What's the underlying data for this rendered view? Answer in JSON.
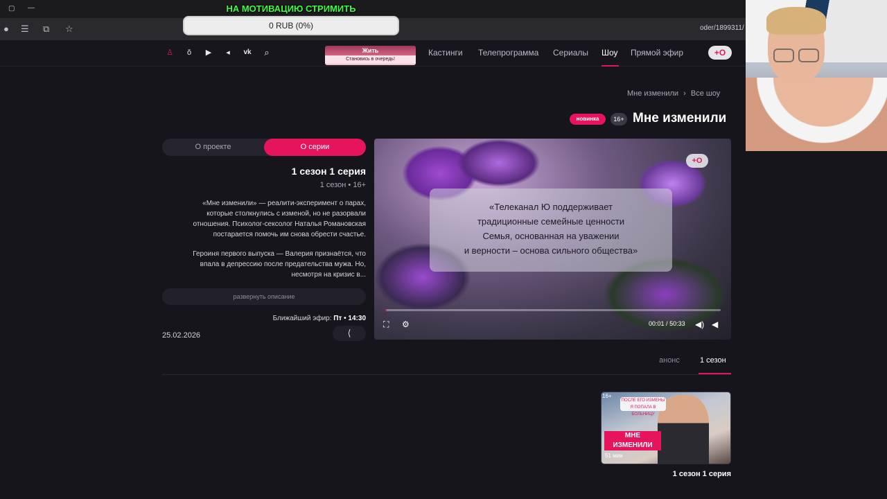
{
  "browser": {
    "url_fragment": "oder/1899311/"
  },
  "donation": {
    "title": "НА МОТИВАЦИЮ СТРИМИТЬ",
    "progress_text": "0 RUB (0%)",
    "progress_fraction": 0
  },
  "site": {
    "logo_text": "+О",
    "nav": [
      {
        "label": "Прямой эфир"
      },
      {
        "label": "Шоу"
      },
      {
        "label": "Сериалы"
      },
      {
        "label": "Телепрограмма"
      },
      {
        "label": "Кастинги"
      }
    ],
    "banner": {
      "title": "Жить",
      "subtitle": "Становись в очередь!"
    },
    "social_icons": [
      "search-icon",
      "vk-icon",
      "telegram-icon",
      "youtube-icon",
      "odnoklassniki-icon",
      "user-icon"
    ]
  },
  "breadcrumbs": {
    "root": "Все шоу",
    "separator": "›",
    "current": "Мне изменили"
  },
  "show": {
    "title": "Мне изменили",
    "age_badge": "16+",
    "new_badge": "новинка"
  },
  "tabs": {
    "active": "О серии",
    "other": "О проекте"
  },
  "episode": {
    "title": "1 сезон 1 серия",
    "meta": "1 сезон • 16+",
    "description_1": [
      "«Мне изменили» — реалити-эксперимент о парах,",
      "которые столкнулись с изменой, но не разорвали",
      "отношения. Психолог-сексолог Наталья Романовская",
      "постарается помочь им снова обрести счастье."
    ],
    "description_2": [
      "Героиня первого выпуска — Валерия признаётся, что",
      "впала в депрессию после предательства мужа. Но,",
      "несмотря на кризис в..."
    ],
    "expand_label": "развернуть описание",
    "next_air_label": "Ближайший эфир:",
    "next_air_value": "Пт • 14:30",
    "date": "25.02.2026"
  },
  "video": {
    "disclaimer": [
      "«Телеканал Ю поддерживает",
      "традиционные семейные ценности",
      "Семья, основанная на уважении",
      "и верности – основа сильного общества»"
    ],
    "logo_text": "+О",
    "time_current": "00:01",
    "time_sep": "/",
    "time_total": "50:33",
    "progress_fraction": 0.002
  },
  "seasons": {
    "active": "1 сезон",
    "other": "анонс"
  },
  "episode_cards": [
    {
      "label": "1 сезон 1 серия",
      "thumb_title": "МНЕ ИЗМЕНИЛИ",
      "thumb_age": "16+",
      "thumb_duration": "51 мин",
      "thumb_bubble": "ПОСЛЕ ЕГО ИЗМЕНЫ Я ПОПАЛА В БОЛЬНИЦУ"
    }
  ],
  "colors": {
    "accent": "#e6145c",
    "background": "#16151c",
    "donation_title": "#3cff3c"
  }
}
